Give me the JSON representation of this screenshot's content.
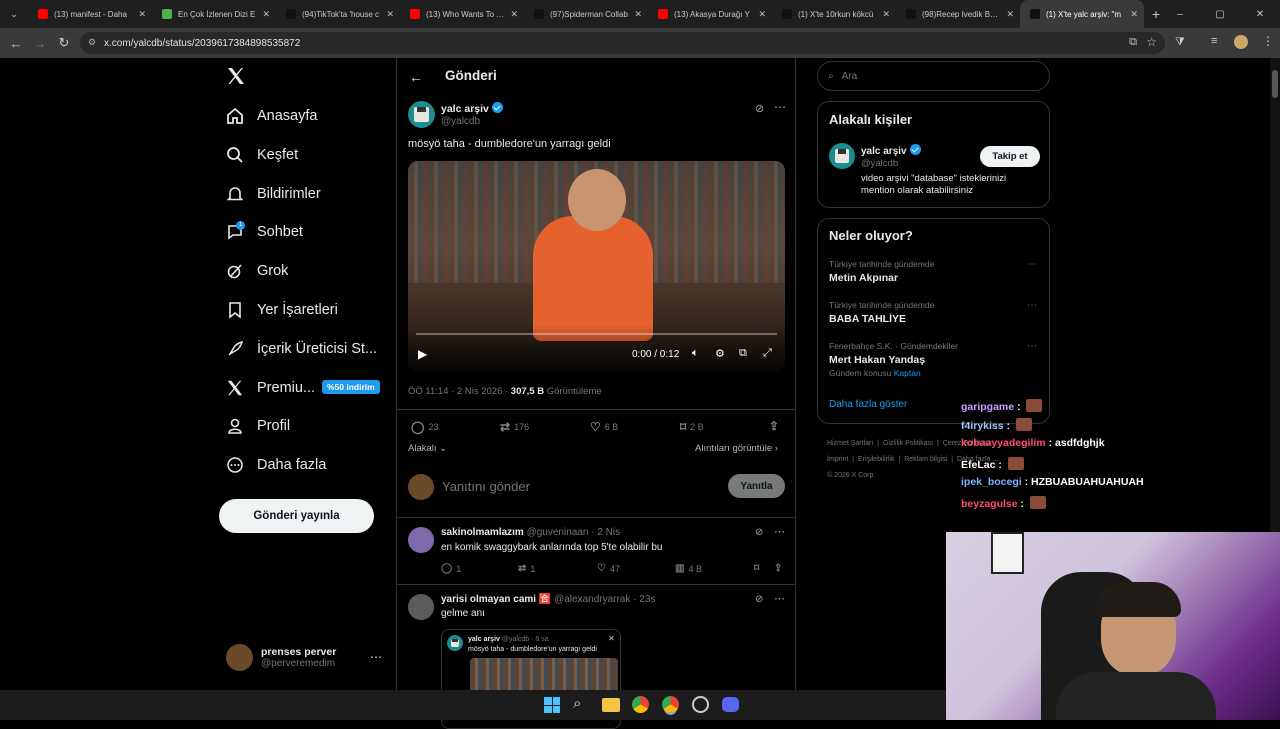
{
  "browser": {
    "tabs": [
      {
        "title": "(13) manifest - Daha",
        "color": "#ff0000"
      },
      {
        "title": "En Çok İzlenen Dizi E",
        "color": "#4caf50"
      },
      {
        "title": "(94)TikTok'ta 'house c",
        "color": "#111111"
      },
      {
        "title": "(13) Who Wants To Be",
        "color": "#ff0000"
      },
      {
        "title": "(97)Spiderman Collab",
        "color": "#111111"
      },
      {
        "title": "(13) Akasya Durağı Y",
        "color": "#ff0000"
      },
      {
        "title": "(1) X'te 10rkun kökcü",
        "color": "#111111"
      },
      {
        "title": "(98)Recep Ivedik Best",
        "color": "#111111"
      },
      {
        "title": "(1) X'te yalc arşiv: \"m",
        "color": "#111111"
      }
    ],
    "url": "x.com/yalcdb/status/2039617384898535872"
  },
  "nav": {
    "items": [
      {
        "label": "Anasayfa",
        "icon": "home-icon"
      },
      {
        "label": "Keşfet",
        "icon": "search-icon"
      },
      {
        "label": "Bildirimler",
        "icon": "bell-icon"
      },
      {
        "label": "Sohbet",
        "icon": "chat-icon"
      },
      {
        "label": "Grok",
        "icon": "grok-icon"
      },
      {
        "label": "Yer İşaretleri",
        "icon": "bookmark-icon"
      },
      {
        "label": "İçerik Üreticisi St...",
        "icon": "rocket-icon"
      },
      {
        "label": "Premiu...",
        "icon": "x-logo-icon"
      },
      {
        "label": "Profil",
        "icon": "person-icon"
      },
      {
        "label": "Daha fazla",
        "icon": "more-circle-icon"
      }
    ],
    "premium_badge": "%50 indirim",
    "chat_badge": "1",
    "post_button": "Gönderi yayınla",
    "account": {
      "name": "prenses perver",
      "handle": "@perveremedim"
    }
  },
  "post": {
    "header_title": "Gönderi",
    "author_name": "yalc arşiv",
    "author_handle": "@yalcdb",
    "text": "mösyö taha - dumbledore'un yarragı geldi",
    "video_time": "0:00 / 0:12",
    "timestamp": "ÖÖ 11:14 · 2 Nis 2026 ·",
    "views_count": "307,5 B",
    "views_label": "Görüntüleme",
    "replies": "23",
    "reposts": "176",
    "likes": "6 B",
    "bookmarks": "2 B",
    "relevant_label": "Alakalı",
    "quotes_label": "Alıntıları görüntüle",
    "reply_placeholder": "Yanıtını gönder",
    "reply_button": "Yanıtla"
  },
  "replies": [
    {
      "name": "sakinolmamlazım",
      "handle": "@guveninaan · 2 Nis",
      "text": "en komik swaggybark anlarında top 5'te olabilir bu",
      "replies": "1",
      "reposts": "1",
      "likes": "47",
      "views": "4 B"
    },
    {
      "name": "yarisi olmayan cami 🈴",
      "handle": "@alexandryarrak · 23s",
      "text": "gelme anı",
      "quote": {
        "name": "yalc arşiv",
        "handle": "@yalcdb · 6 sa",
        "text": "mösyö taha - dumbledore'un yarragı geldi"
      }
    }
  ],
  "right": {
    "search_placeholder": "Ara",
    "relevant_title": "Alakalı kişiler",
    "relevant_person": {
      "name": "yalc arşiv",
      "handle": "@yalcdb",
      "bio": "video arşivi \"database\" isteklerinizi mention olarak atabilirsiniz",
      "follow": "Takip et"
    },
    "trends_title": "Neler oluyor?",
    "trends": [
      {
        "context": "Türkiye tarihinde gündemde",
        "name": "Metin Akpınar"
      },
      {
        "context": "Türkiye tarihinde gündemde",
        "name": "BABA TAHLİYE"
      },
      {
        "context": "Fenerbahçe S.K. · Gündemdekiler",
        "name": "Mert Hakan Yandaş",
        "extra_prefix": "Gündem konusu",
        "extra_link": "Kaptan"
      }
    ],
    "show_more": "Daha fazla göster",
    "footer_links": [
      "Hizmet Şartları",
      "Gizlilik Politikası",
      "Çerez Politikası",
      "İmprint",
      "Erişilebilirlik",
      "Reklam bilgisi",
      "Daha fazla ...",
      "© 2026 X Corp."
    ]
  },
  "chat": [
    {
      "user": "garipgame",
      "color": "#c8a2ff",
      "msg": ""
    },
    {
      "user": "f4irykiss",
      "color": "#9ec9ff",
      "msg": ""
    },
    {
      "user": "kobaayyadegilim",
      "color": "#ff4d6d",
      "msg": "asdfdghjk"
    },
    {
      "user": "EfeLac",
      "color": "#ffffff",
      "msg": ""
    },
    {
      "user": "ipek_bocegi",
      "color": "#7fb2ff",
      "msg": "HZBUABUAHUAHUAH"
    },
    {
      "user": "beyzagulse",
      "color": "#ff4d6d",
      "msg": ""
    }
  ]
}
